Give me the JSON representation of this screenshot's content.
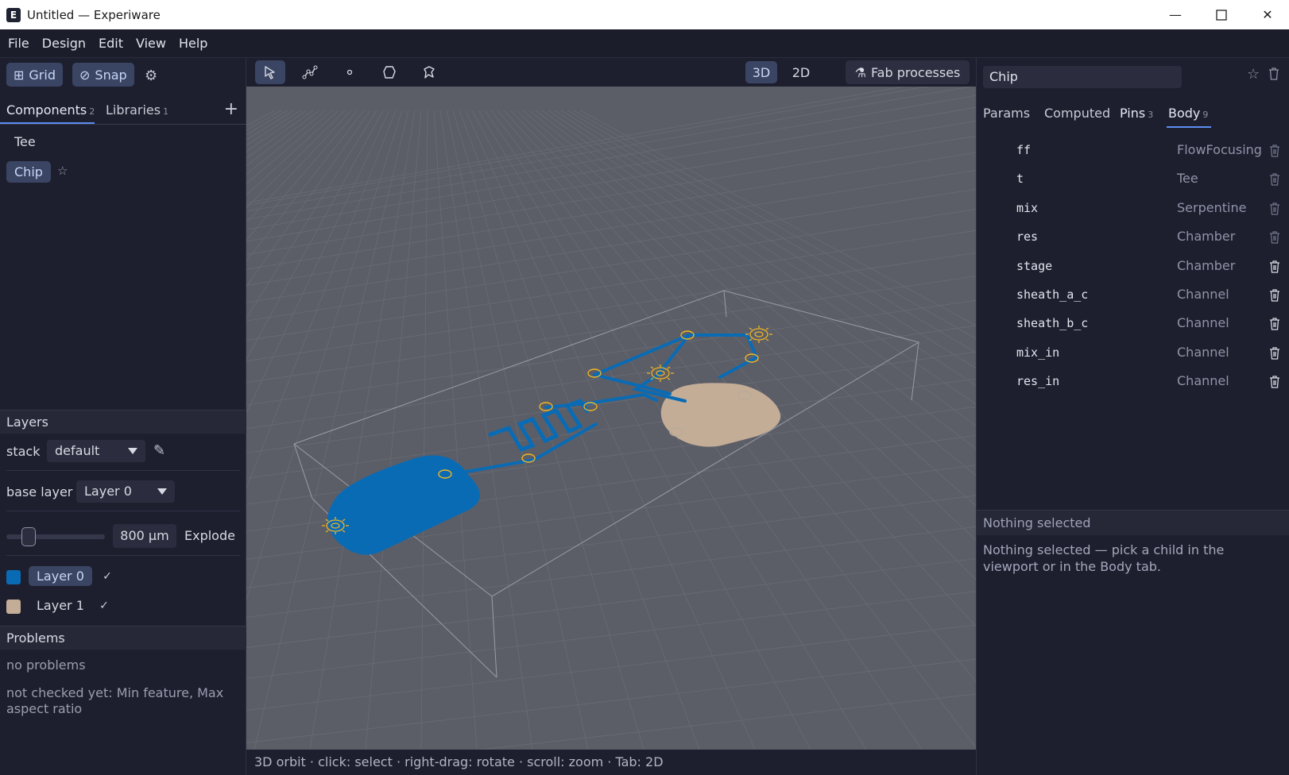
{
  "window": {
    "title": "Untitled — Experiware",
    "logo": "E"
  },
  "menu": [
    "File",
    "Design",
    "Edit",
    "View",
    "Help"
  ],
  "left": {
    "grid_label": "Grid",
    "snap_label": "Snap",
    "tabs": [
      {
        "label": "Components",
        "count": "2"
      },
      {
        "label": "Libraries",
        "count": "1"
      }
    ],
    "components": [
      "Tee",
      "Chip"
    ],
    "layers": {
      "header": "Layers",
      "stack_label": "stack",
      "stack_value": "default",
      "base_layer_label": "base layer",
      "base_layer_value": "Layer 0",
      "explode_value": "800 µm",
      "explode_label": "Explode",
      "explode_fraction": 0.18,
      "items": [
        {
          "name": "Layer 0",
          "color": "#0a6bb5",
          "visible": true
        },
        {
          "name": "Layer 1",
          "color": "#c4ad97",
          "visible": true
        }
      ]
    },
    "problems": {
      "header": "Problems",
      "status": "no problems",
      "note": "not checked yet: Min feature, Max aspect ratio"
    }
  },
  "viewport": {
    "view_3d": "3D",
    "view_2d": "2D",
    "fab_label": "Fab processes",
    "status": "3D orbit · click: select · right-drag: rotate · scroll: zoom · Tab: 2D",
    "colors": {
      "background": "#5b5e67",
      "layer0": "#0a6bb5",
      "layer1": "#c4ad97",
      "port": "#f0b323"
    }
  },
  "right": {
    "name_value": "Chip",
    "tabs": [
      {
        "label": "Params",
        "count": ""
      },
      {
        "label": "Computed",
        "count": ""
      },
      {
        "label": "Pins",
        "count": "3"
      },
      {
        "label": "Body",
        "count": "9"
      }
    ],
    "body": [
      {
        "name": "ff",
        "type": "FlowFocusing"
      },
      {
        "name": "t",
        "type": "Tee"
      },
      {
        "name": "mix",
        "type": "Serpentine"
      },
      {
        "name": "res",
        "type": "Chamber"
      },
      {
        "name": "stage",
        "type": "Chamber"
      },
      {
        "name": "sheath_a_c",
        "type": "Channel"
      },
      {
        "name": "sheath_b_c",
        "type": "Channel"
      },
      {
        "name": "mix_in",
        "type": "Channel"
      },
      {
        "name": "res_in",
        "type": "Channel"
      }
    ],
    "selection_header": "Nothing selected",
    "selection_text": "Nothing selected — pick a child in the viewport or in the Body tab."
  }
}
